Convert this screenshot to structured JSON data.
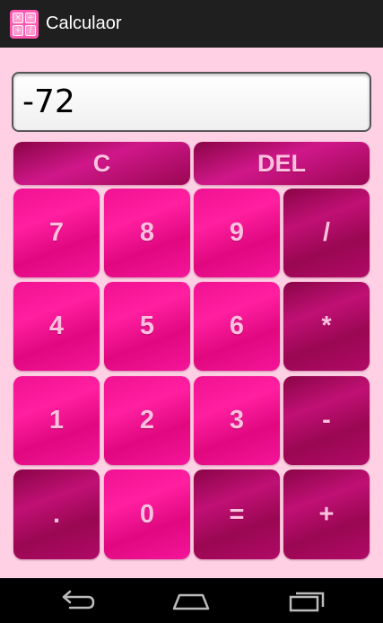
{
  "app": {
    "title": "Calculaor",
    "icon_glyphs": [
      "×",
      "÷",
      "+",
      "/"
    ]
  },
  "display": {
    "value": "-72"
  },
  "buttons": {
    "clear": "C",
    "delete": "DEL",
    "seven": "7",
    "eight": "8",
    "nine": "9",
    "divide": "/",
    "four": "4",
    "five": "5",
    "six": "6",
    "multiply": "*",
    "one": "1",
    "two": "2",
    "three": "3",
    "subtract": "-",
    "decimal": ".",
    "zero": "0",
    "equals": "=",
    "add": "+"
  },
  "nav": {
    "icons": [
      "back-icon",
      "home-icon",
      "recents-icon"
    ]
  },
  "colors": {
    "background": "#ffd0e4",
    "key_light": "#ff1fa0",
    "key_dark": "#b00a66",
    "key_text": "#ffc0e0",
    "action_bar": "#1f1f1f",
    "nav_bar": "#000000"
  }
}
